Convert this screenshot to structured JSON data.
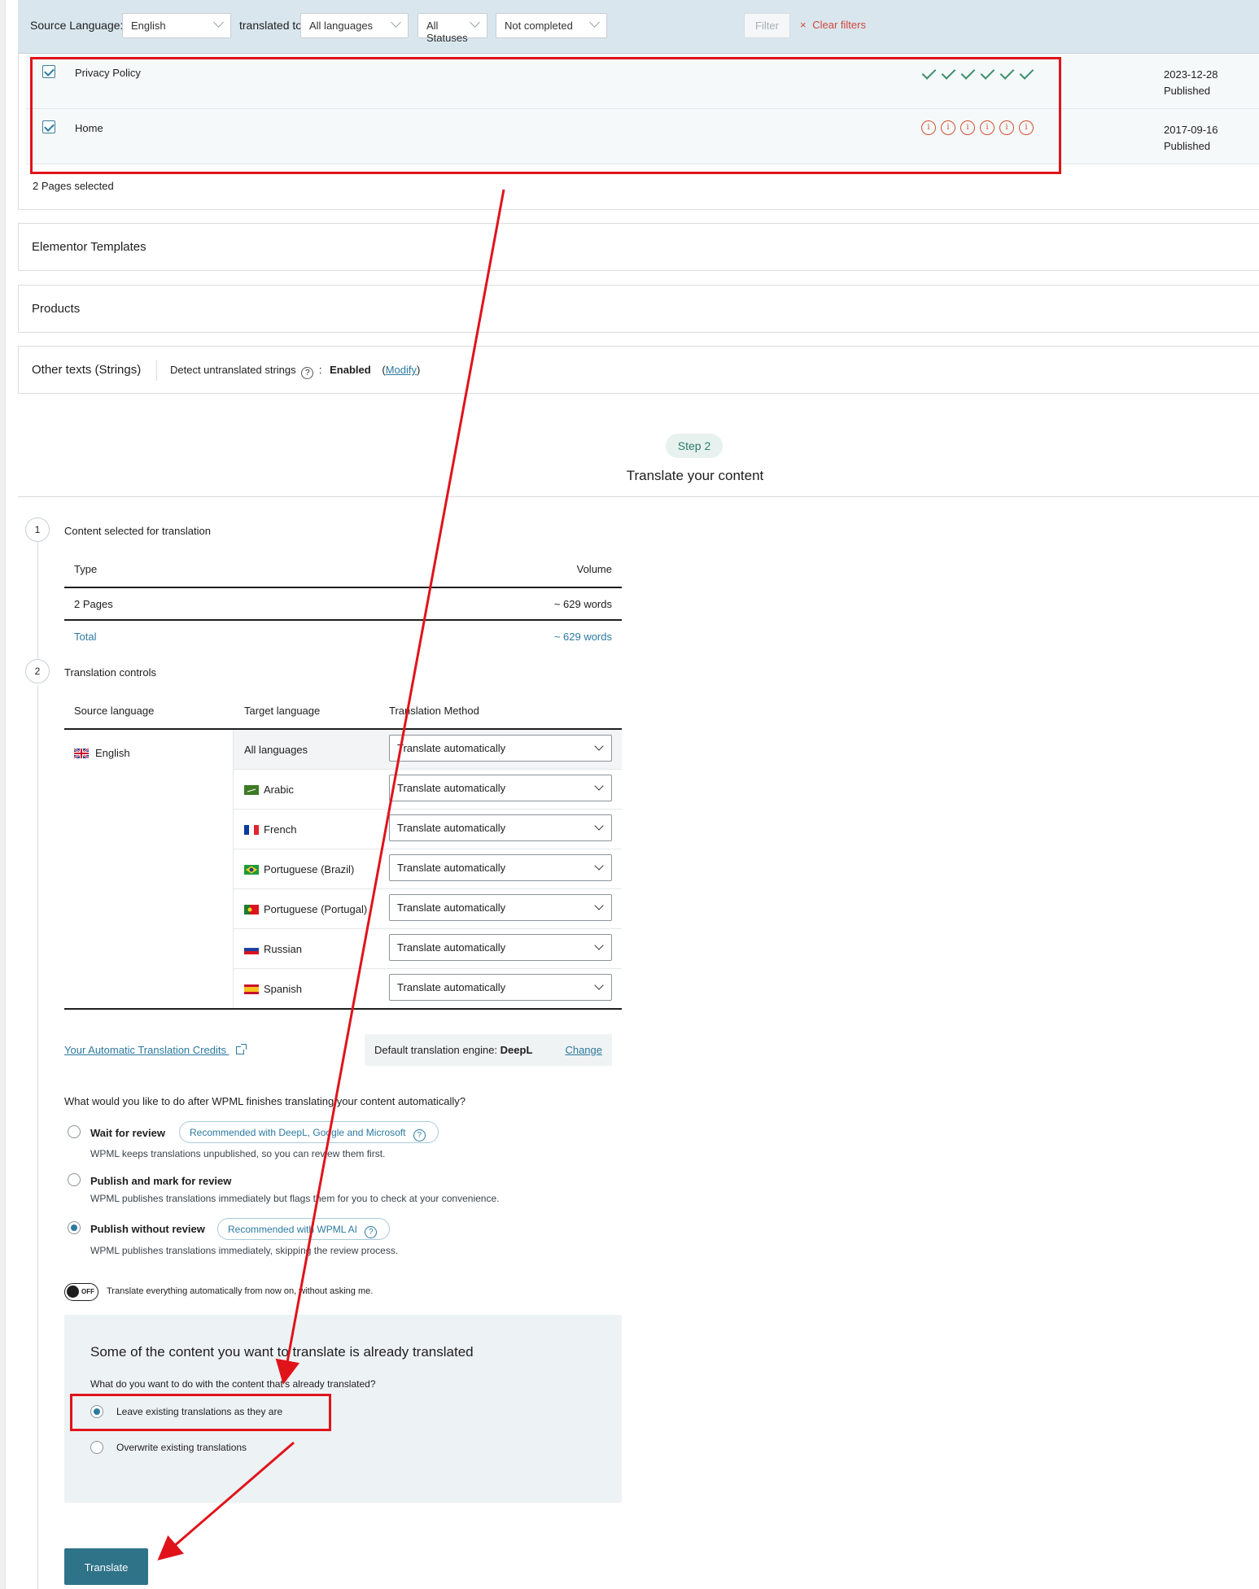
{
  "filters": {
    "source_language_label": "Source Language:",
    "source_language_value": "English",
    "translated_to_label": "translated to:",
    "translated_to_value": "All languages",
    "status_value": "All Statuses",
    "completion_value": "Not completed",
    "filter_button": "Filter",
    "clear_filters": "Clear filters",
    "clear_icon": "×"
  },
  "pages": {
    "rows": [
      {
        "title": "Privacy Policy",
        "date": "2023-12-28",
        "status": "Published",
        "icons": "check",
        "icon_count": 6
      },
      {
        "title": "Home",
        "date": "2017-09-16",
        "status": "Published",
        "icons": "info",
        "icon_count": 6
      }
    ],
    "selected_count": "2 Pages selected"
  },
  "sections": {
    "elementor": "Elementor Templates",
    "products": "Products",
    "strings": "Other texts (Strings)",
    "detect_label": "Detect untranslated strings",
    "detect_colon": ":",
    "detect_value": "Enabled",
    "modify_open": "(",
    "modify": "Modify",
    "modify_close": ")"
  },
  "step": {
    "badge": "Step 2",
    "title": "Translate your content"
  },
  "content_selected": {
    "number": "1",
    "title": "Content selected for translation",
    "col_type": "Type",
    "col_volume": "Volume",
    "row_type": "2 Pages",
    "row_volume": "~ 629 words",
    "total_label": "Total",
    "total_volume": "~ 629 words"
  },
  "controls": {
    "number": "2",
    "title": "Translation controls",
    "col_source": "Source language",
    "col_target": "Target language",
    "col_method": "Translation Method",
    "source_language": "English",
    "rows": [
      {
        "language": "All languages",
        "method": "Translate automatically",
        "flag": ""
      },
      {
        "language": "Arabic",
        "method": "Translate automatically",
        "flag": "flag-arabic"
      },
      {
        "language": "French",
        "method": "Translate automatically",
        "flag": "flag-french"
      },
      {
        "language": "Portuguese (Brazil)",
        "method": "Translate automatically",
        "flag": "flag-brazil"
      },
      {
        "language": "Portuguese (Portugal)",
        "method": "Translate automatically",
        "flag": "flag-portugal"
      },
      {
        "language": "Russian",
        "method": "Translate automatically",
        "flag": "flag-russia"
      },
      {
        "language": "Spanish",
        "method": "Translate automatically",
        "flag": "flag-spain"
      }
    ]
  },
  "credits": {
    "link": "Your Automatic Translation Credits",
    "engine_label": "Default translation engine:",
    "engine_value": "DeepL",
    "change": "Change"
  },
  "review": {
    "question": "What would you like to do after WPML finishes translating your content automatically?",
    "options": [
      {
        "title": "Wait for review",
        "pill": "Recommended with DeepL, Google and Microsoft",
        "desc": "WPML keeps translations unpublished, so you can review them first.",
        "selected": false
      },
      {
        "title": "Publish and mark for review",
        "pill": "",
        "desc": "WPML publishes translations immediately but flags them for you to check at your convenience.",
        "selected": false
      },
      {
        "title": "Publish without review",
        "pill": "Recommended with WPML AI",
        "desc": "WPML publishes translations immediately, skipping the review process.",
        "selected": true
      }
    ],
    "pill_help": "?"
  },
  "toggle": {
    "state": "OFF",
    "label": "Translate everything automatically from now on, without asking me."
  },
  "already": {
    "title": "Some of the content you want to translate is already translated",
    "question": "What do you want to do with the content that's already translated?",
    "option_leave": "Leave existing translations as they are",
    "option_overwrite": "Overwrite existing translations",
    "selected": "leave"
  },
  "translate_button": "Translate",
  "annotation_color": "#e0131b",
  "accent_color": "#2c7aa0"
}
